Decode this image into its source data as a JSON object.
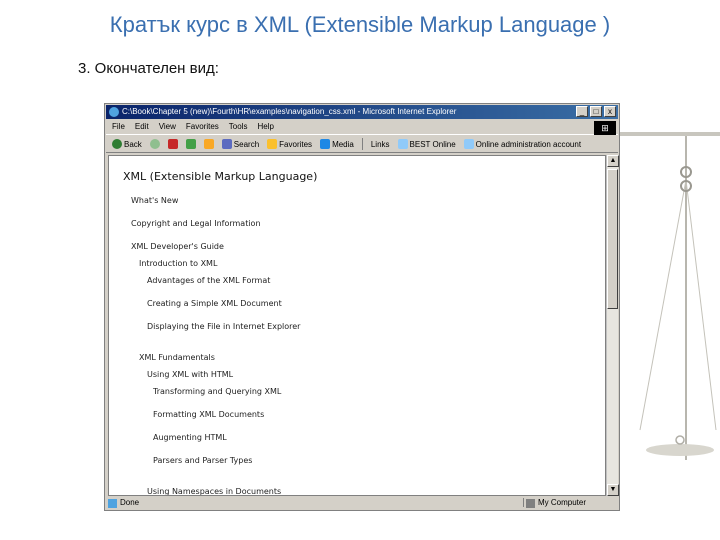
{
  "slide": {
    "title": "Кратък курс в XML (Extensible Markup Language )",
    "subtitle": "3. Окончателен вид:"
  },
  "browser": {
    "window_title": "C:\\Book\\Chapter 5 (new)\\Fourth\\HR\\examples\\navigation_css.xml - Microsoft Internet Explorer",
    "window_buttons": [
      "_",
      "□",
      "x"
    ],
    "menu": [
      "File",
      "Edit",
      "View",
      "Favorites",
      "Tools",
      "Help"
    ],
    "toolbar": {
      "back": "Back",
      "search": "Search",
      "favorites": "Favorites",
      "media": "Media",
      "links": "Links",
      "link1": "BEST Online",
      "link2": "Online administration account"
    },
    "status": {
      "left": "Done",
      "right": "My Computer"
    }
  },
  "document": {
    "heading": "XML (Extensible Markup Language)",
    "items": [
      {
        "text": "What's New",
        "indent": 0
      },
      {
        "text": "Copyright and Legal Information",
        "indent": 0
      },
      {
        "text": "XML Developer's Guide",
        "indent": 0
      },
      {
        "text": "Introduction to XML",
        "indent": 1
      },
      {
        "text": "Advantages of the XML Format",
        "indent": 2
      },
      {
        "text": "Creating a Simple XML Document",
        "indent": 2
      },
      {
        "text": "Displaying the File in Internet Explorer",
        "indent": 2
      },
      {
        "text": "XML Fundamentals",
        "indent": 1
      },
      {
        "text": "Using XML with HTML",
        "indent": 2
      },
      {
        "text": "Transforming and Querying XML",
        "indent": 3
      },
      {
        "text": "Formatting XML Documents",
        "indent": 3
      },
      {
        "text": "Augmenting HTML",
        "indent": 3
      },
      {
        "text": "Parsers and Parser Types",
        "indent": 3
      },
      {
        "text": "Using Namespaces in Documents",
        "indent": 2
      }
    ]
  },
  "colors": {
    "title": "#3a6fb0",
    "titlebar_start": "#0a246a",
    "titlebar_end": "#3a6ea5",
    "chrome": "#d4d0c8"
  },
  "icons": [
    "ie-icon",
    "back-arrow-icon",
    "forward-arrow-icon",
    "stop-icon",
    "refresh-icon",
    "home-icon",
    "search-icon",
    "favorites-icon",
    "media-icon",
    "links-icon",
    "scale-of-justice-icon"
  ]
}
